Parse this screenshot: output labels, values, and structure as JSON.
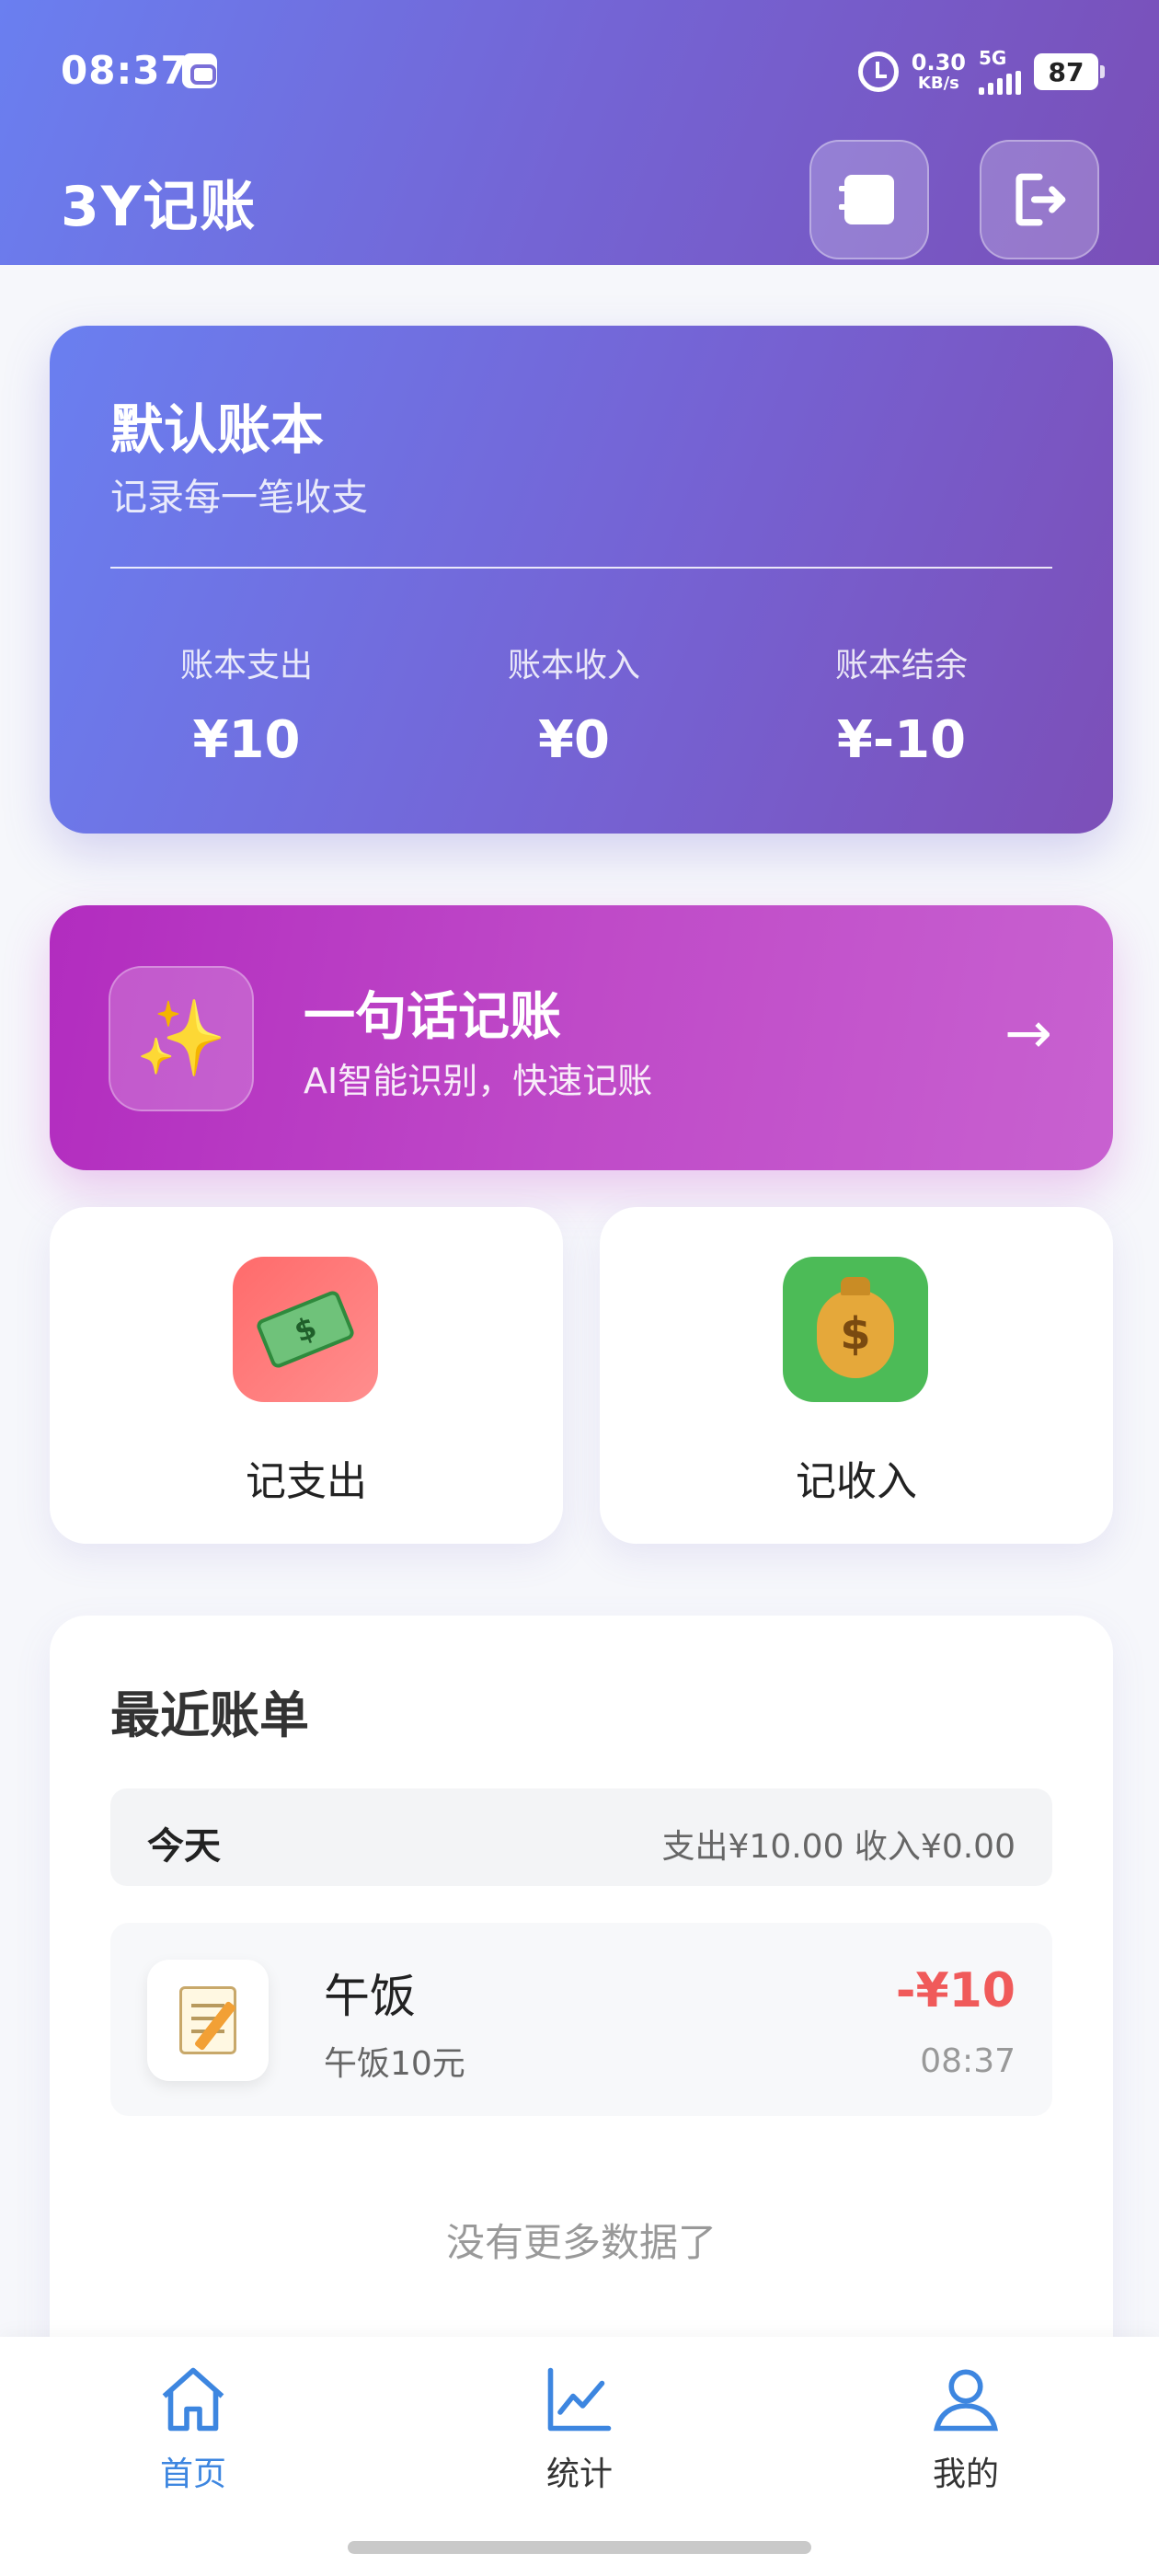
{
  "status_bar": {
    "time": "08:37",
    "net_speed": "0.30",
    "net_unit": "KB/s",
    "network": "5G",
    "battery": "87"
  },
  "header": {
    "title": "3Y记账",
    "icons": [
      "book-icon",
      "logout-icon"
    ]
  },
  "account_book": {
    "name": "默认账本",
    "description": "记录每一笔收支",
    "stats": [
      {
        "label": "账本支出",
        "value": "¥10"
      },
      {
        "label": "账本收入",
        "value": "¥0"
      },
      {
        "label": "账本结余",
        "value": "¥-10"
      }
    ]
  },
  "ai_entry": {
    "icon": "sparkles-icon",
    "title": "一句话记账",
    "subtitle": "AI智能识别，快速记账",
    "arrow": "→"
  },
  "quick_actions": [
    {
      "label": "记支出",
      "icon": "money-with-wings-icon",
      "color": "#ff6b6b"
    },
    {
      "label": "记收入",
      "icon": "money-bag-icon",
      "color": "#4cbb57"
    }
  ],
  "recent": {
    "title": "最近账单",
    "day": {
      "label": "今天",
      "summary": "支出¥10.00 收入¥0.00"
    },
    "entries": [
      {
        "icon": "memo-icon",
        "title": "午饭",
        "note": "午饭10元",
        "amount": "-¥10",
        "time": "08:37"
      }
    ],
    "no_more": "没有更多数据了"
  },
  "tabbar": {
    "items": [
      {
        "label": "首页",
        "icon": "home-icon",
        "active": true
      },
      {
        "label": "统计",
        "icon": "chart-icon",
        "active": false
      },
      {
        "label": "我的",
        "icon": "user-icon",
        "active": false
      }
    ],
    "active_color": "#3d86e0"
  }
}
